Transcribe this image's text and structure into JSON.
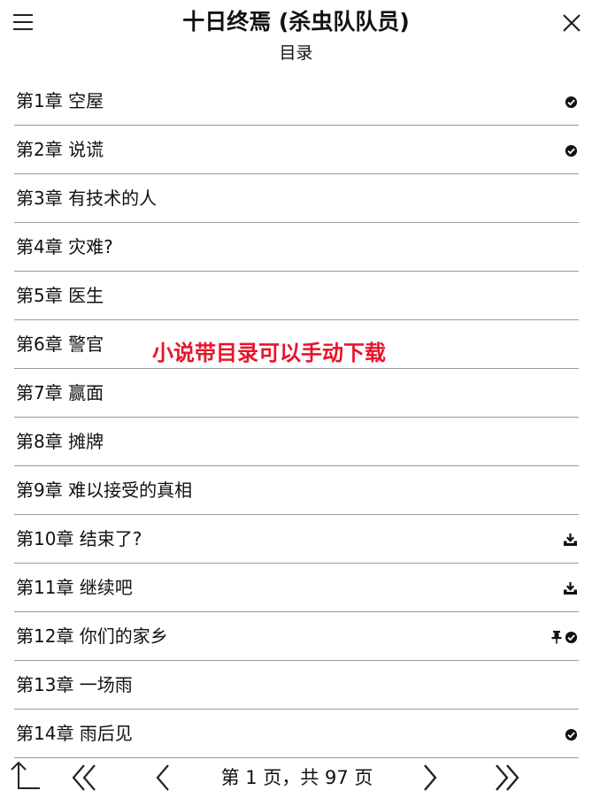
{
  "header": {
    "title": "十日终焉 (杀虫队队员)",
    "subtitle": "目录",
    "menu_icon": "hamburger-menu-icon",
    "close_icon": "close-icon"
  },
  "chapters": [
    {
      "label": "第1章 空屋",
      "status": [
        "read"
      ]
    },
    {
      "label": "第2章 说谎",
      "status": [
        "read"
      ]
    },
    {
      "label": "第3章 有技术的人",
      "status": []
    },
    {
      "label": "第4章 灾难?",
      "status": []
    },
    {
      "label": "第5章 医生",
      "status": []
    },
    {
      "label": "第6章 警官",
      "status": []
    },
    {
      "label": "第7章 赢面",
      "status": []
    },
    {
      "label": "第8章 摊牌",
      "status": []
    },
    {
      "label": "第9章 难以接受的真相",
      "status": []
    },
    {
      "label": "第10章 结束了?",
      "status": [
        "download"
      ]
    },
    {
      "label": "第11章 继续吧",
      "status": [
        "download"
      ]
    },
    {
      "label": "第12章 你们的家乡",
      "status": [
        "pin",
        "read"
      ]
    },
    {
      "label": "第13章 一场雨",
      "status": []
    },
    {
      "label": "第14章 雨后见",
      "status": [
        "read"
      ]
    }
  ],
  "overlay_caption": "小说带目录可以手动下载",
  "footer": {
    "page_info": "第 1 页，共 97 页",
    "current_page": 1,
    "total_pages": 97
  },
  "colors": {
    "text": "#111111",
    "divider": "#9a9a9a",
    "caption": "#e8142b"
  }
}
